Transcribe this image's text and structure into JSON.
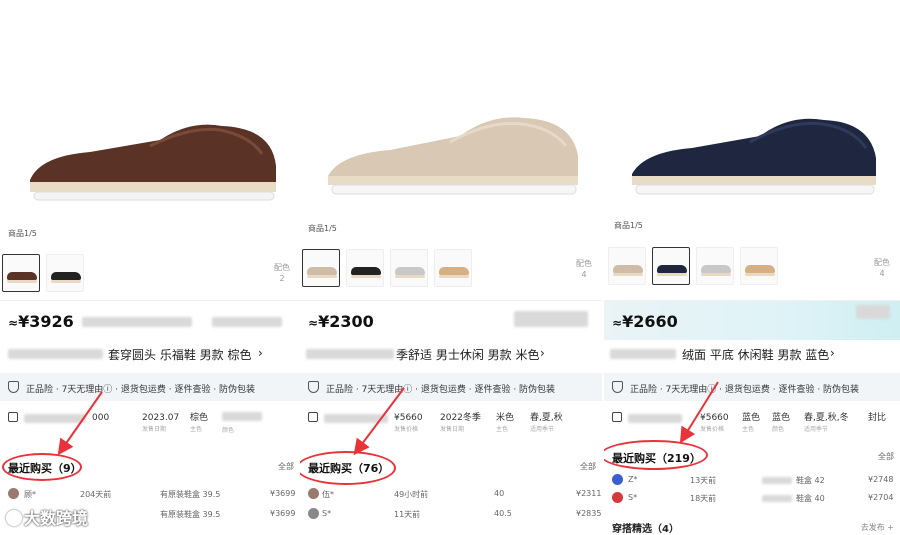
{
  "panels": [
    {
      "page_indicator": "商品1/5",
      "color_count": [
        "配色",
        "2"
      ],
      "price": "3926",
      "price_symbol": "¥",
      "approx": "≈",
      "title": "套穿圆头 乐福鞋 男款 棕色",
      "guarantee": "正品险 · 7天无理由ⓘ · 退货包运费 · 逐件查验 · 防伪包装",
      "info_cells": [
        {
          "value": "000",
          "sub": ""
        },
        {
          "value": "2023.07",
          "sub": "发售日期"
        },
        {
          "value": "棕色",
          "sub": "主色"
        },
        {
          "value": "",
          "sub": "颜色"
        }
      ],
      "recent_label": "最近购买",
      "recent_count": "（9）",
      "all_label": "全部",
      "purchases": [
        {
          "user": "顾*",
          "time": "204天前",
          "spec": "有原装鞋盒 39.5",
          "price": "¥3699"
        },
        {
          "user": "",
          "time": "",
          "spec": "有原装鞋盒 39.5",
          "price": "¥3699"
        }
      ],
      "shoe_color": "#5a3326",
      "upper_hi": "#7a4a38"
    },
    {
      "page_indicator": "商品1/5",
      "color_count": [
        "配色",
        "4"
      ],
      "price": "2300",
      "price_symbol": "¥",
      "approx": "≈",
      "title": "季舒适 男士休闲 男款 米色",
      "guarantee": "正品险 · 7天无理由ⓘ · 退货包运费 · 逐件查验 · 防伪包装",
      "info_cells": [
        {
          "value": "¥5660",
          "sub": "发售价格"
        },
        {
          "value": "2022冬季",
          "sub": "发售日期"
        },
        {
          "value": "米色",
          "sub": "主色"
        },
        {
          "value": "春,夏,秋",
          "sub": "适用季节"
        }
      ],
      "recent_label": "最近购买",
      "recent_count": "（76）",
      "all_label": "全部",
      "purchases": [
        {
          "user": "伍*",
          "time": "49小时前",
          "spec": "40",
          "price": "¥2311"
        },
        {
          "user": "S*",
          "time": "11天前",
          "spec": "40.5",
          "price": "¥2835"
        }
      ],
      "shoe_color": "#d8c8b4",
      "upper_hi": "#e6d9c8"
    },
    {
      "page_indicator": "商品1/5",
      "color_count": [
        "配色",
        "4"
      ],
      "price": "2660",
      "price_symbol": "¥",
      "approx": "≈",
      "title": "绒面 平底 休闲鞋 男款 蓝色",
      "guarantee": "正品险 · 7天无理由ⓘ · 退货包运费 · 逐件查验 · 防伪包装",
      "info_cells": [
        {
          "value": "¥5660",
          "sub": "发售价格"
        },
        {
          "value": "蓝色",
          "sub": "主色"
        },
        {
          "value": "蓝色",
          "sub": "颜色"
        },
        {
          "value": "春,夏,秋,冬",
          "sub": "适用季节"
        },
        {
          "value": "封比",
          "sub": ""
        }
      ],
      "recent_label": "最近购买",
      "recent_count": "（219）",
      "all_label": "全部",
      "purchases": [
        {
          "user": "Z*",
          "time": "13天前",
          "spec": "鞋盒 42",
          "price": "¥2748"
        },
        {
          "user": "S*",
          "time": "18天前",
          "spec": "鞋盒 40",
          "price": "¥2704"
        }
      ],
      "outfit_label": "穿搭精选（4）",
      "outfit_more": "去发布",
      "shoe_color": "#1f2740",
      "upper_hi": "#2f3a5a"
    }
  ],
  "watermark": "大数跨境",
  "colors": {
    "highlight": "#e8333a",
    "guarantee_bg": "#f1f5f8"
  }
}
